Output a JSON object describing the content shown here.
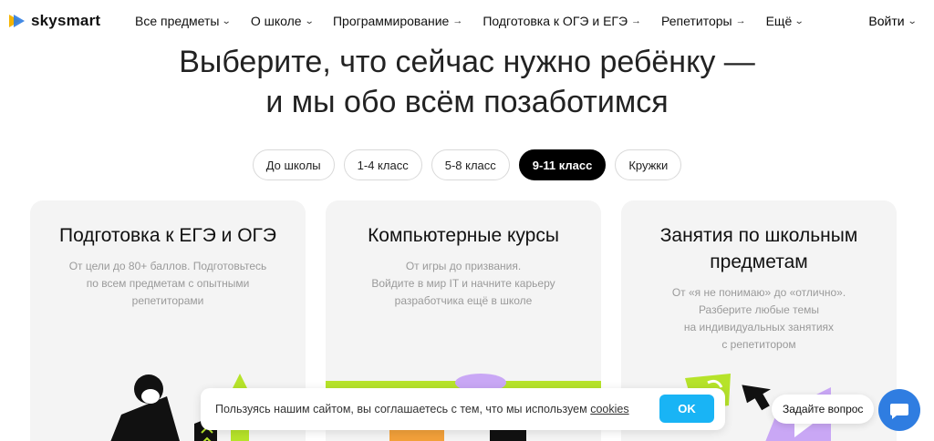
{
  "header": {
    "logo_text": "skysmart",
    "nav": [
      {
        "label": "Все предметы",
        "indicator": "chevron-down"
      },
      {
        "label": "О школе",
        "indicator": "chevron-down"
      },
      {
        "label": "Программирование",
        "indicator": "arrow-right"
      },
      {
        "label": "Подготовка к ОГЭ и ЕГЭ",
        "indicator": "arrow-right"
      },
      {
        "label": "Репетиторы",
        "indicator": "arrow-right"
      },
      {
        "label": "Ещё",
        "indicator": "chevron-down"
      }
    ],
    "login_label": "Войти"
  },
  "hero": {
    "title_line1": "Выберите, что сейчас нужно ребёнку —",
    "title_line2": "и мы обо всём позаботимся"
  },
  "filters": [
    {
      "label": "До школы",
      "active": false
    },
    {
      "label": "1-4 класс",
      "active": false
    },
    {
      "label": "5-8 класс",
      "active": false
    },
    {
      "label": "9-11 класс",
      "active": true
    },
    {
      "label": "Кружки",
      "active": false
    }
  ],
  "cards": [
    {
      "title": "Подготовка к ЕГЭ и ОГЭ",
      "desc_lines": [
        "От цели до 80+ баллов. Подготовьтесь",
        "по всем предметам с опытными",
        "репетиторами"
      ]
    },
    {
      "title": "Компьютерные курсы",
      "desc_lines": [
        "От игры до призвания.",
        "Войдите в мир IT и начните карьеру",
        "разработчика ещё в школе"
      ]
    },
    {
      "title": "Занятия по школьным предметам",
      "desc_lines": [
        "От «я не понимаю» до «отлично».",
        "Разберите любые темы",
        "на индивидуальных занятиях",
        "с репетитором"
      ]
    }
  ],
  "cookie": {
    "text": "Пользуясь нашим сайтом, вы соглашаетесь с тем, что мы используем",
    "link_text": "cookies",
    "ok_label": "OK"
  },
  "chat": {
    "ask_label": "Задайте вопрос"
  },
  "colors": {
    "accent_blue": "#19b4f5",
    "chat_blue": "#2f7de1",
    "lime": "#b6e32a",
    "purple": "#c9a7f5"
  }
}
